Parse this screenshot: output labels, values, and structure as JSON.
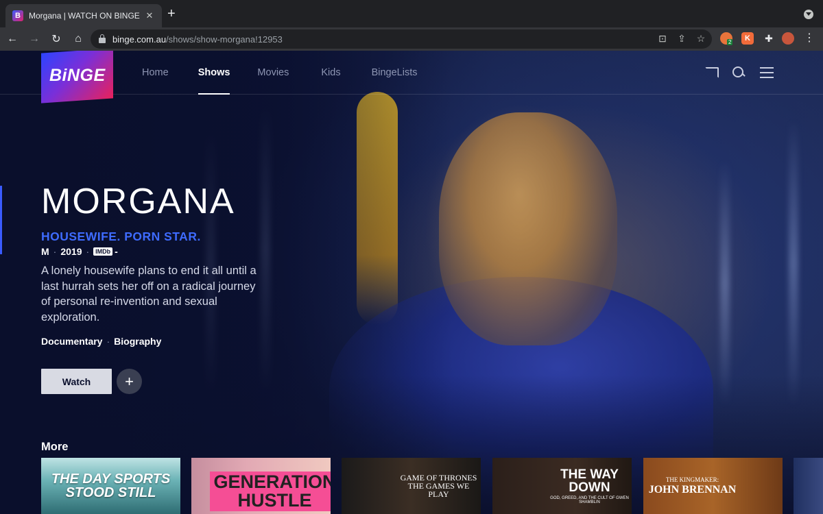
{
  "browser": {
    "tab_title": "Morgana | WATCH ON BINGE",
    "tab_favicon_letter": "B",
    "url_domain": "binge.com.au",
    "url_path": "/shows/show-morgana!12953",
    "extension_badge": "2",
    "extension_letter": "K"
  },
  "site": {
    "logo_text": "BiNGE",
    "nav": [
      {
        "label": "Home",
        "active": false
      },
      {
        "label": "Shows",
        "active": true
      },
      {
        "label": "Movies",
        "active": false
      },
      {
        "label": "Kids",
        "active": false
      },
      {
        "label": "BingeLists",
        "active": false
      }
    ]
  },
  "hero": {
    "title": "MORGANA",
    "tagline": "HOUSEWIFE. PORN STAR.",
    "rating": "M",
    "year": "2019",
    "imdb_label": "IMDb",
    "imdb_score": "-",
    "description": "A lonely housewife plans to end it all until a last hurrah sets her off on a radical journey of personal re-invention and sexual exploration.",
    "genres": [
      "Documentary",
      "Biography"
    ],
    "watch_label": "Watch",
    "add_label": "+"
  },
  "more": {
    "label": "More",
    "tiles": [
      {
        "title": "The Day Sports Stood Still",
        "subtitle": ""
      },
      {
        "title": "Generation Hustle",
        "subtitle": ""
      },
      {
        "title": "Game of Thrones The Games We Play",
        "subtitle": ""
      },
      {
        "title": "The Way Down",
        "subtitle": "God, Greed, and the Cult of Gwen Shamblin"
      },
      {
        "title": "John Brennan",
        "subtitle": "The Kingmaker:"
      }
    ]
  },
  "colors": {
    "accent": "#3e6bff",
    "background": "#0a0f2c",
    "watch_button": "#d8dae3"
  }
}
